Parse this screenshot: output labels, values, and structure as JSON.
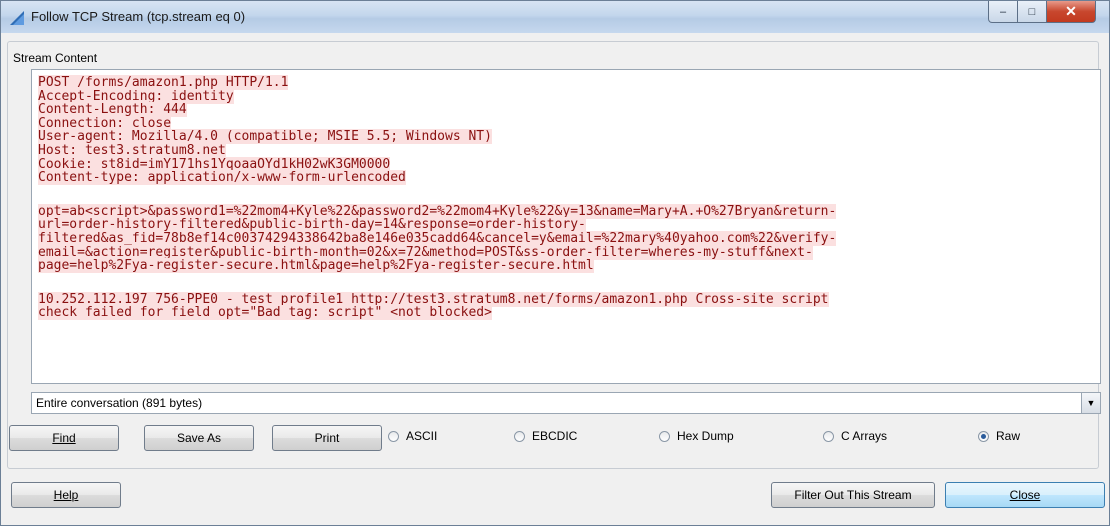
{
  "window": {
    "title": "Follow TCP Stream (tcp.stream eq 0)",
    "controls": {
      "minimize": "–",
      "maximize": "□",
      "close": "✕"
    }
  },
  "group": {
    "label": "Stream Content"
  },
  "stream": {
    "lines_block1": [
      "POST /forms/amazon1.php HTTP/1.1",
      "Accept-Encoding: identity",
      "Content-Length: 444",
      "Connection: close",
      "User-agent: Mozilla/4.0 (compatible; MSIE 5.5; Windows NT)",
      "Host: test3.stratum8.net",
      "Cookie: st8id=imY171hs1YqoaaOYd1kH02wK3GM0000",
      "Content-type: application/x-www-form-urlencoded"
    ],
    "lines_block2": [
      "opt=ab<script>&password1=%22mom4+Kyle%22&password2=%22mom4+Kyle%22&y=13&name=Mary+A.+O%27Bryan&return-",
      "url=order-history-filtered&public-birth-day=14&response=order-history-",
      "filtered&as_fid=78b8ef14c00374294338642ba8e146e035cadd64&cancel=y&email=%22mary%40yahoo.com%22&verify-",
      "email=&action=register&public-birth-month=02&x=72&method=POST&ss-order-filter=wheres-my-stuff&next-",
      "page=help%2Fya-register-secure.html&page=help%2Fya-register-secure.html"
    ],
    "lines_block3": [
      "10.252.112.197 756-PPE0 - test_profile1 http://test3.stratum8.net/forms/amazon1.php Cross-site script",
      "check failed for field opt=\"Bad tag: script\" <not blocked>"
    ]
  },
  "conversation": {
    "selected": "Entire conversation (891 bytes)"
  },
  "buttons": {
    "find": "Find",
    "save_as": "Save As",
    "print": "Print",
    "help": "Help",
    "filter_out": "Filter Out This Stream",
    "close": "Close"
  },
  "radios": [
    {
      "label": "ASCII",
      "checked": false
    },
    {
      "label": "EBCDIC",
      "checked": false
    },
    {
      "label": "Hex Dump",
      "checked": false
    },
    {
      "label": "C Arrays",
      "checked": false
    },
    {
      "label": "Raw",
      "checked": true
    }
  ],
  "colors": {
    "stream_text": "#8a1010",
    "stream_highlight": "#fbe0e0"
  }
}
